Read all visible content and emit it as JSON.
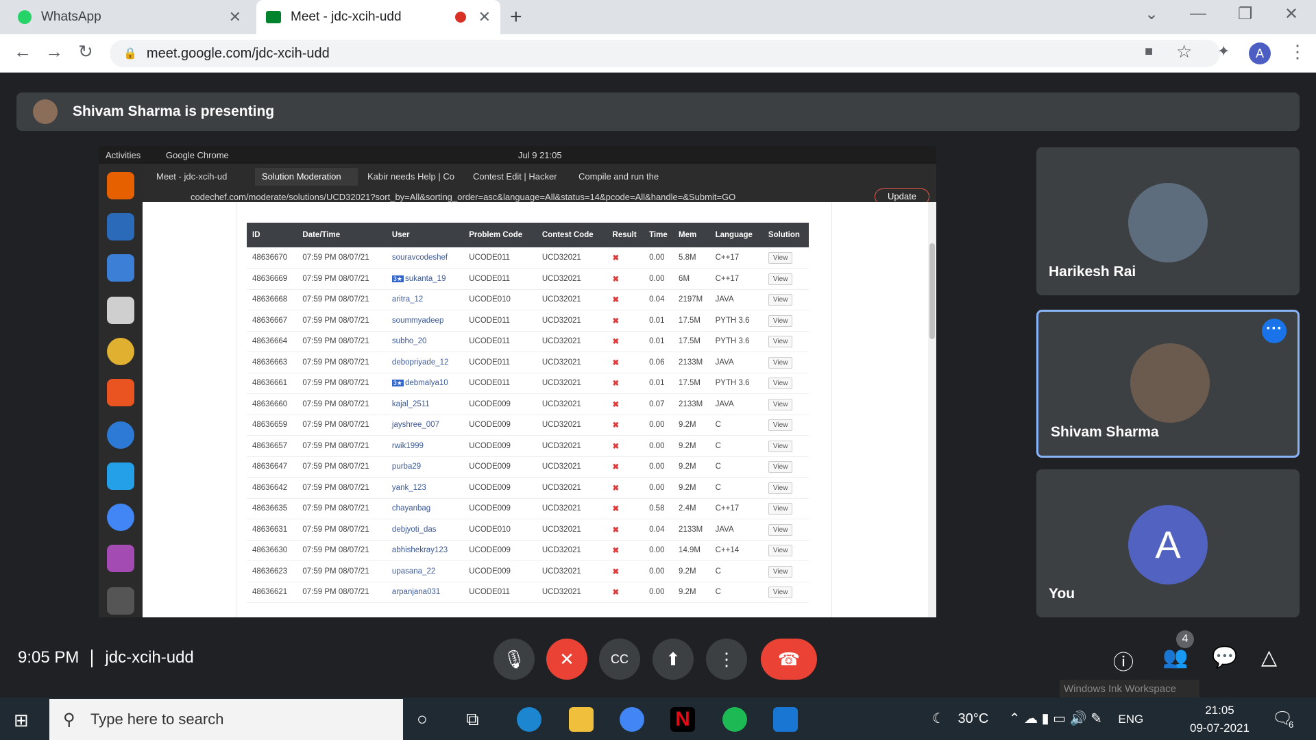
{
  "browser": {
    "tabs": [
      {
        "label": "WhatsApp"
      },
      {
        "label": "Meet - jdc-xcih-udd"
      }
    ],
    "url": "meet.google.com/jdc-xcih-udd",
    "profile_initial": "A"
  },
  "meet": {
    "presenting_banner": "Shivam Sharma is presenting",
    "time": "9:05 PM",
    "code": "jdc-xcih-udd",
    "participant_count": "4",
    "participants": [
      {
        "name": "Harikesh Rai"
      },
      {
        "name": "Shivam Sharma"
      },
      {
        "name": "You",
        "initial": "A"
      }
    ],
    "tooltip": "Windows Ink Workspace"
  },
  "shared": {
    "topbar": {
      "activities": "Activities",
      "app": "Google Chrome",
      "datetime": "Jul 9  21:05"
    },
    "tabs": [
      "Meet - jdc-xcih-ud",
      "Solution Moderation",
      "Kabir needs Help | Co",
      "Contest Edit | Hacker",
      "Compile and run the"
    ],
    "url": "codechef.com/moderate/solutions/UCD32021?sort_by=All&sorting_order=asc&language=All&status=14&pcode=All&handle=&Submit=GO",
    "update": "Update",
    "columns": [
      "ID",
      "Date/Time",
      "User",
      "Problem Code",
      "Contest Code",
      "Result",
      "Time",
      "Mem",
      "Language",
      "Solution"
    ],
    "rows": [
      [
        "48636670",
        "07:59 PM 08/07/21",
        "souravcodeshef",
        "UCODE011",
        "UCD32021",
        "✖",
        "0.00",
        "5.8M",
        "C++17",
        "View"
      ],
      [
        "48636669",
        "07:59 PM 08/07/21",
        "sukanta_19",
        "UCODE011",
        "UCD32021",
        "✖",
        "0.00",
        "6M",
        "C++17",
        "View"
      ],
      [
        "48636668",
        "07:59 PM 08/07/21",
        "aritra_12",
        "UCODE010",
        "UCD32021",
        "✖",
        "0.04",
        "2197M",
        "JAVA",
        "View"
      ],
      [
        "48636667",
        "07:59 PM 08/07/21",
        "soummyadeep",
        "UCODE011",
        "UCD32021",
        "✖",
        "0.01",
        "17.5M",
        "PYTH 3.6",
        "View"
      ],
      [
        "48636664",
        "07:59 PM 08/07/21",
        "subho_20",
        "UCODE011",
        "UCD32021",
        "✖",
        "0.01",
        "17.5M",
        "PYTH 3.6",
        "View"
      ],
      [
        "48636663",
        "07:59 PM 08/07/21",
        "debopriyade_12",
        "UCODE011",
        "UCD32021",
        "✖",
        "0.06",
        "2133M",
        "JAVA",
        "View"
      ],
      [
        "48636661",
        "07:59 PM 08/07/21",
        "debmalya10",
        "UCODE011",
        "UCD32021",
        "✖",
        "0.01",
        "17.5M",
        "PYTH 3.6",
        "View"
      ],
      [
        "48636660",
        "07:59 PM 08/07/21",
        "kajal_2511",
        "UCODE009",
        "UCD32021",
        "✖",
        "0.07",
        "2133M",
        "JAVA",
        "View"
      ],
      [
        "48636659",
        "07:59 PM 08/07/21",
        "jayshree_007",
        "UCODE009",
        "UCD32021",
        "✖",
        "0.00",
        "9.2M",
        "C",
        "View"
      ],
      [
        "48636657",
        "07:59 PM 08/07/21",
        "rwik1999",
        "UCODE009",
        "UCD32021",
        "✖",
        "0.00",
        "9.2M",
        "C",
        "View"
      ],
      [
        "48636647",
        "07:59 PM 08/07/21",
        "purba29",
        "UCODE009",
        "UCD32021",
        "✖",
        "0.00",
        "9.2M",
        "C",
        "View"
      ],
      [
        "48636642",
        "07:59 PM 08/07/21",
        "yank_123",
        "UCODE009",
        "UCD32021",
        "✖",
        "0.00",
        "9.2M",
        "C",
        "View"
      ],
      [
        "48636635",
        "07:59 PM 08/07/21",
        "chayanbag",
        "UCODE009",
        "UCD32021",
        "✖",
        "0.58",
        "2.4M",
        "C++17",
        "View"
      ],
      [
        "48636631",
        "07:59 PM 08/07/21",
        "debjyoti_das",
        "UCODE010",
        "UCD32021",
        "✖",
        "0.04",
        "2133M",
        "JAVA",
        "View"
      ],
      [
        "48636630",
        "07:59 PM 08/07/21",
        "abhishekray123",
        "UCODE009",
        "UCD32021",
        "✖",
        "0.00",
        "14.9M",
        "C++14",
        "View"
      ],
      [
        "48636623",
        "07:59 PM 08/07/21",
        "upasana_22",
        "UCODE009",
        "UCD32021",
        "✖",
        "0.00",
        "9.2M",
        "C",
        "View"
      ],
      [
        "48636621",
        "07:59 PM 08/07/21",
        "arpanjana031",
        "UCODE011",
        "UCD32021",
        "✖",
        "0.00",
        "9.2M",
        "C",
        "View"
      ]
    ],
    "star_users": [
      "sukanta_19",
      "debmalya10"
    ],
    "star_label": "3★"
  },
  "taskbar": {
    "search_placeholder": "Type here to search",
    "weather": "30°C",
    "language": "ENG",
    "time": "21:05",
    "date": "09-07-2021",
    "notifications": "6"
  }
}
